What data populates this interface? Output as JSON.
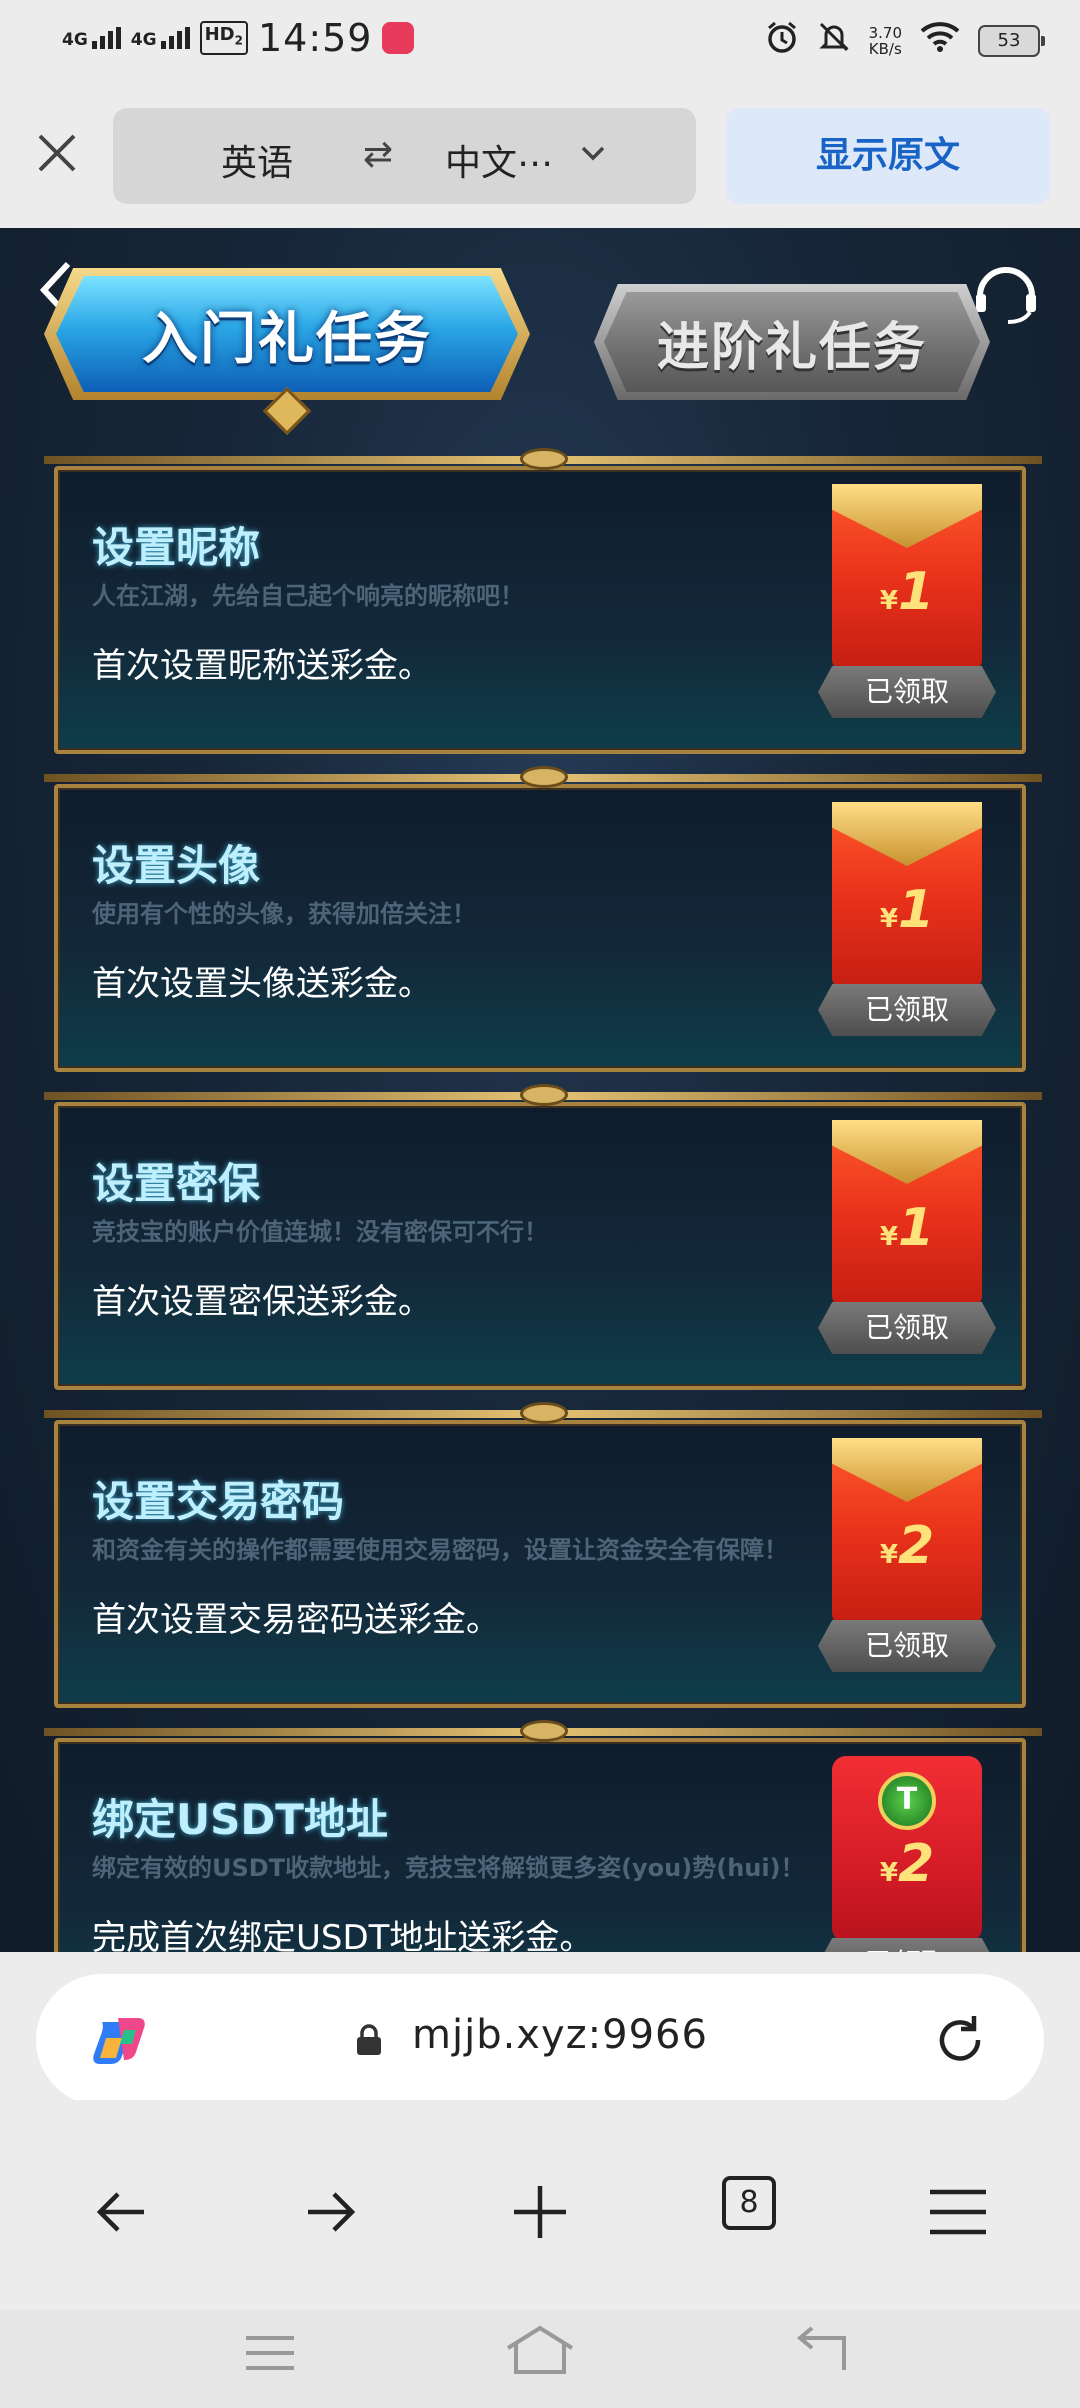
{
  "status": {
    "net1": "4G",
    "net2": "4G",
    "hd": "HD",
    "hd_sub": "2",
    "time": "14:59",
    "speed_value": "3.70",
    "speed_unit": "KB/s",
    "battery": "53"
  },
  "translate": {
    "source_lang": "英语",
    "swap_icon": "⇄",
    "target_lang": "中文⋯",
    "show_original": "显示原文"
  },
  "page": {
    "tabs": [
      {
        "label": "入门礼任务",
        "active": true
      },
      {
        "label": "进阶礼任务",
        "active": false
      }
    ],
    "tasks": [
      {
        "title": "设置昵称",
        "subtitle": "人在江湖，先给自己起个响亮的昵称吧！",
        "desc": "首次设置昵称送彩金。",
        "currency": "¥",
        "amount": "1",
        "status": "已领取"
      },
      {
        "title": "设置头像",
        "subtitle": "使用有个性的头像，获得加倍关注！",
        "desc": "首次设置头像送彩金。",
        "currency": "¥",
        "amount": "1",
        "status": "已领取"
      },
      {
        "title": "设置密保",
        "subtitle": "竞技宝的账户价值连城！没有密保可不行！",
        "desc": "首次设置密保送彩金。",
        "currency": "¥",
        "amount": "1",
        "status": "已领取"
      },
      {
        "title": "设置交易密码",
        "subtitle": "和资金有关的操作都需要使用交易密码，设置让资金安全有保障！",
        "desc": "首次设置交易密码送彩金。",
        "currency": "¥",
        "amount": "2",
        "status": "已领取"
      },
      {
        "title": "绑定USDT地址",
        "subtitle": "绑定有效的USDT收款地址，竞技宝将解锁更多姿(you)势(hui)！",
        "desc": "完成首次绑定USDT地址送彩金。",
        "currency": "¥",
        "amount": "2",
        "status": "已领取"
      }
    ]
  },
  "browser": {
    "url": "mjjb.xyz:9966",
    "tab_count": "8"
  }
}
